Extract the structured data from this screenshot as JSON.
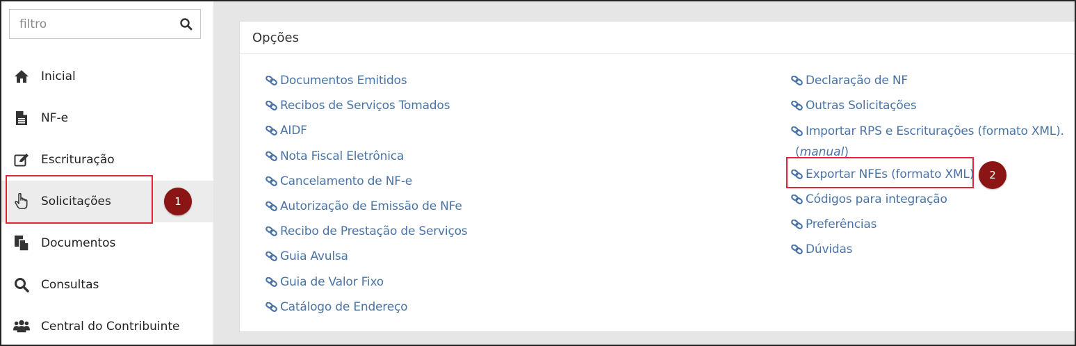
{
  "search": {
    "placeholder": "filtro",
    "icon": "search-icon"
  },
  "sidebar": {
    "items": [
      {
        "label": "Inicial",
        "icon": "home-icon"
      },
      {
        "label": "NF-e",
        "icon": "document-icon"
      },
      {
        "label": "Escrituração",
        "icon": "edit-icon"
      },
      {
        "label": "Solicitações",
        "icon": "pointing-hand-icon"
      },
      {
        "label": "Documentos",
        "icon": "copy-icon"
      },
      {
        "label": "Consultas",
        "icon": "magnifier-icon"
      },
      {
        "label": "Central do Contribuinte",
        "icon": "users-icon"
      }
    ],
    "active_index": 3
  },
  "annotations": {
    "badge_1": "1",
    "badge_2": "2",
    "highlight_color": "#e0263a",
    "badge_color": "#8b1414"
  },
  "panel": {
    "title": "Opções",
    "left_links": [
      "Documentos Emitidos",
      "Recibos de Serviços Tomados",
      "AIDF",
      "Nota Fiscal Eletrônica",
      "Cancelamento de NF-e",
      "Autorização de Emissão de NFe",
      "Recibo de Prestação de Serviços",
      "Guia Avulsa",
      "Guia de Valor Fixo",
      "Catálogo de Endereço"
    ],
    "right_links": [
      "Declaração de NF",
      "Outras Solicitações",
      "Importar RPS e Escriturações (formato XML).",
      "Exportar NFEs (formato XML)",
      "Códigos para integração",
      "Preferências",
      "Dúvidas"
    ],
    "manual_open": "(",
    "manual_text": "manual",
    "manual_close": ")",
    "link_color": "#4a73a6"
  }
}
